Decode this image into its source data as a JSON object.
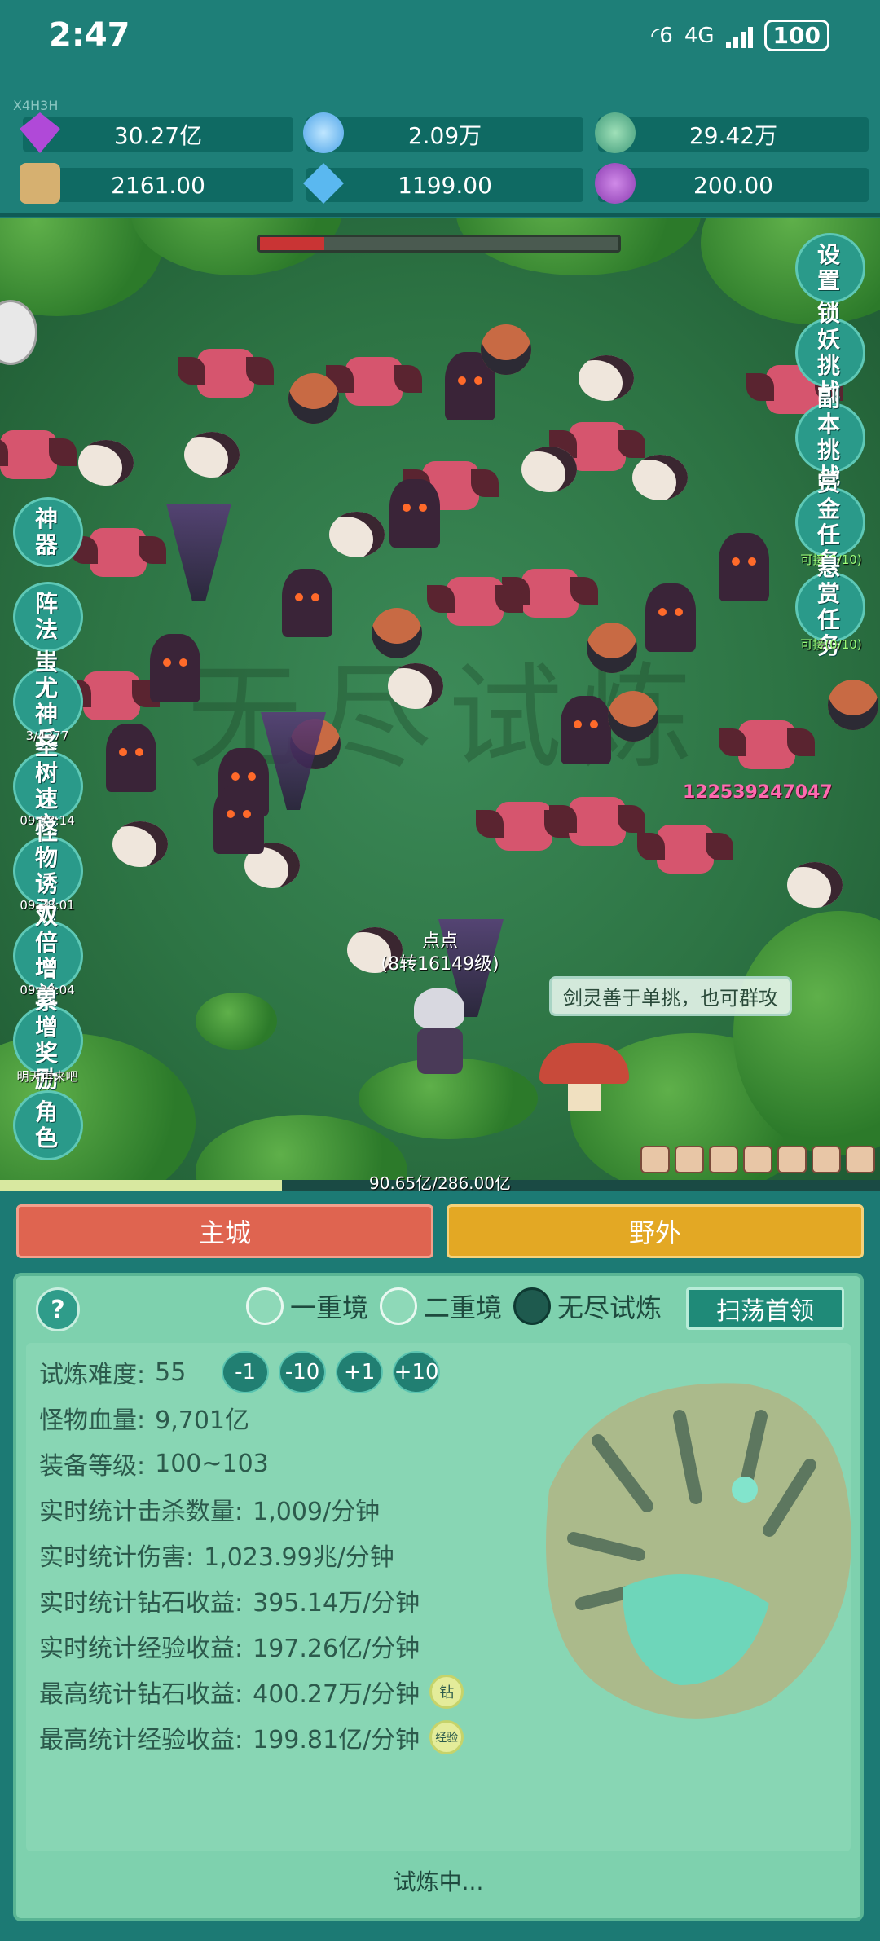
{
  "status_bar": {
    "time": "2:47",
    "network": "4G",
    "wifi_label": "6",
    "battery": "100"
  },
  "resources": {
    "code": "X4H3H",
    "items": [
      {
        "icon": "diamond-icon",
        "value": "30.27亿",
        "color": "#b049d8"
      },
      {
        "icon": "blue-orb-icon",
        "value": "2.09万",
        "color": "#4aa2e8"
      },
      {
        "icon": "globe-icon",
        "value": "29.42万",
        "color": "#3f9a7a"
      },
      {
        "icon": "scroll-icon",
        "value": "2161.00",
        "color": "#d6b070"
      },
      {
        "icon": "crystal-icon",
        "value": "1199.00",
        "color": "#5ab8f0"
      },
      {
        "icon": "purple-pot-icon",
        "value": "200.00",
        "color": "#8a3ab0"
      }
    ]
  },
  "battle": {
    "watermark": "无尽试炼",
    "boss_hp_fraction": 0.18,
    "damage_number": "122539247047",
    "player_name": "点点",
    "player_level": "(8转16149级)",
    "speech": "剑灵善于单挑，也可群攻",
    "exp_text": "90.65亿/286.00亿",
    "exp_fraction": 0.32
  },
  "left_buttons": [
    {
      "id": "pause",
      "label": ""
    },
    {
      "id": "artifact",
      "label": "神器",
      "sub": ""
    },
    {
      "id": "formation",
      "label": "阵法",
      "sub": ""
    },
    {
      "id": "chiyou",
      "label": "蚩尤神兵",
      "sub": "3/4377"
    },
    {
      "id": "tree",
      "label": "圣树速充",
      "sub": "09:38:14"
    },
    {
      "id": "lure",
      "label": "怪物诱引",
      "sub": "09:38:01"
    },
    {
      "id": "double",
      "label": "双倍增益",
      "sub": "09:38:04"
    },
    {
      "id": "cumulative",
      "label": "累增奖励",
      "sub": "明天再来吧"
    },
    {
      "id": "character",
      "label": "角色",
      "sub": ""
    }
  ],
  "right_buttons": [
    {
      "id": "settings",
      "label": "设置",
      "sub": ""
    },
    {
      "id": "demon",
      "label": "锁妖挑战",
      "sub": ""
    },
    {
      "id": "dungeon",
      "label": "副本挑战",
      "sub": ""
    },
    {
      "id": "reward-task",
      "label": "赏金任务",
      "sub": "可接(0/10)"
    },
    {
      "id": "bounty-task",
      "label": "悬赏任务",
      "sub": "可接(0/10)"
    }
  ],
  "tabs": {
    "main_city": "主城",
    "wild": "野外"
  },
  "panel": {
    "help": "?",
    "modes": [
      {
        "label": "一重境",
        "selected": false
      },
      {
        "label": "二重境",
        "selected": false
      },
      {
        "label": "无尽试炼",
        "selected": true
      }
    ],
    "sweep_button": "扫荡首领",
    "difficulty_label": "试炼难度:",
    "difficulty_value": "55",
    "diff_buttons": [
      "-1",
      "-10",
      "+1",
      "+10"
    ],
    "stats": [
      {
        "label": "怪物血量:",
        "value": "9,701亿"
      },
      {
        "label": "装备等级:",
        "value": "100~103"
      },
      {
        "label": "实时统计击杀数量:",
        "value": "1,009/分钟"
      },
      {
        "label": "实时统计伤害:",
        "value": "1,023.99兆/分钟"
      },
      {
        "label": "实时统计钻石收益:",
        "value": "395.14万/分钟"
      },
      {
        "label": "实时统计经验收益:",
        "value": "197.26亿/分钟"
      },
      {
        "label": "最高统计钻石收益:",
        "value": "400.27万/分钟",
        "tag": "钻"
      },
      {
        "label": "最高统计经验收益:",
        "value": "199.81亿/分钟",
        "tag": "经验"
      }
    ],
    "status": "试炼中..."
  }
}
